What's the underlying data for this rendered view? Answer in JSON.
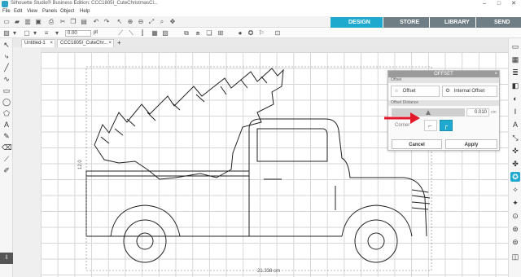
{
  "window": {
    "title": "Silhouette Studio® Business Edition: CCC1805I_CuteChristmasCl...",
    "minimize": "–",
    "maximize": "□",
    "close": "✕"
  },
  "menu": [
    "File",
    "Edit",
    "View",
    "Panels",
    "Object",
    "Help"
  ],
  "nav_tabs": [
    {
      "label": "DESIGN",
      "color": "#20a9cf"
    },
    {
      "label": "STORE",
      "color": "#6f7d85"
    },
    {
      "label": "LIBRARY",
      "color": "#6f7d85"
    },
    {
      "label": "SEND",
      "color": "#6f7d85"
    }
  ],
  "toolbar2": {
    "value_field": "0.00",
    "unit": "pt"
  },
  "doc_tab": {
    "label": "Untitled-1",
    "label2": "CCC1805I_CuteChr...",
    "close": "×",
    "add": "+"
  },
  "dimensions": {
    "width": "21.338 cm",
    "height": "12.0"
  },
  "offset_panel": {
    "title": "OFFSET",
    "section_offset": "Offset",
    "offset_btn": "Offset",
    "internal_offset_btn": "Internal Offset",
    "section_distance": "Offset Distance",
    "distance_value": "0.010",
    "distance_unit": "cm",
    "corner_label": "Corner",
    "cancel": "Cancel",
    "apply": "Apply"
  },
  "colors": {
    "accent": "#20a9cf",
    "arrow": "#e3182a"
  }
}
